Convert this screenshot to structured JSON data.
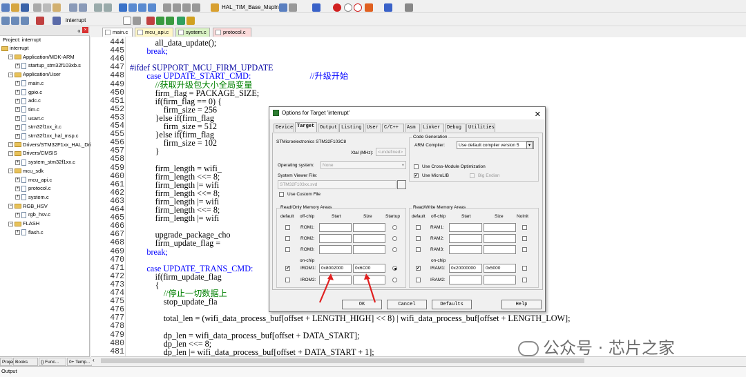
{
  "toolbar": {
    "target_func": "HAL_TIM_Base_MspInit",
    "target_name": "interrupt"
  },
  "project": {
    "header": "Project: interrupt",
    "tree": [
      {
        "label": "interrupt",
        "level": 0,
        "kind": "root"
      },
      {
        "label": "Application/MDK-ARM",
        "level": 1,
        "kind": "folder"
      },
      {
        "label": "startup_stm32f103xb.s",
        "level": 2,
        "kind": "file"
      },
      {
        "label": "Application/User",
        "level": 1,
        "kind": "folder"
      },
      {
        "label": "main.c",
        "level": 2,
        "kind": "file"
      },
      {
        "label": "gpio.c",
        "level": 2,
        "kind": "file"
      },
      {
        "label": "adc.c",
        "level": 2,
        "kind": "file"
      },
      {
        "label": "tim.c",
        "level": 2,
        "kind": "file"
      },
      {
        "label": "usart.c",
        "level": 2,
        "kind": "file"
      },
      {
        "label": "stm32f1xx_it.c",
        "level": 2,
        "kind": "file"
      },
      {
        "label": "stm32f1xx_hal_msp.c",
        "level": 2,
        "kind": "file"
      },
      {
        "label": "Drivers/STM32F1xx_HAL_Driver",
        "level": 1,
        "kind": "folder"
      },
      {
        "label": "Drivers/CMSIS",
        "level": 1,
        "kind": "folder"
      },
      {
        "label": "system_stm32f1xx.c",
        "level": 2,
        "kind": "file"
      },
      {
        "label": "mcu_sdk",
        "level": 1,
        "kind": "folder"
      },
      {
        "label": "mcu_api.c",
        "level": 2,
        "kind": "file"
      },
      {
        "label": "protocol.c",
        "level": 2,
        "kind": "file"
      },
      {
        "label": "system.c",
        "level": 2,
        "kind": "file"
      },
      {
        "label": "RGB_HSV",
        "level": 1,
        "kind": "folder"
      },
      {
        "label": "rgb_hsv.c",
        "level": 2,
        "kind": "file"
      },
      {
        "label": "FLASH",
        "level": 1,
        "kind": "folder"
      },
      {
        "label": "flash.c",
        "level": 2,
        "kind": "file"
      }
    ],
    "bottom_tabs": [
      "Project",
      "Books",
      "{} Func...",
      "0+ Temp..."
    ]
  },
  "editor_tabs": [
    {
      "label": "main.c",
      "color": "#ffffff"
    },
    {
      "label": "mcu_api.c",
      "color": "#fff7c8"
    },
    {
      "label": "system.c",
      "color": "#d9f2c4"
    },
    {
      "label": "protocol.c",
      "color": "#fbdada"
    }
  ],
  "code": {
    "lines": [
      {
        "n": "444",
        "t": "            all_data_update();",
        "c": ""
      },
      {
        "n": "445",
        "t": "        break;",
        "c": "kw"
      },
      {
        "n": "446",
        "t": "",
        "c": ""
      },
      {
        "n": "447",
        "t": "#ifdef SUPPORT_MCU_FIRM_UPDATE",
        "c": "pp"
      },
      {
        "n": "448",
        "t": "        case UPDATE_START_CMD:                            //升级开始",
        "c": "kw"
      },
      {
        "n": "449",
        "t": "            //获取升级包大小全局变量",
        "c": "cm"
      },
      {
        "n": "450",
        "t": "            firm_flag = PACKAGE_SIZE;",
        "c": ""
      },
      {
        "n": "451",
        "t": "            if(firm_flag == 0) {",
        "c": ""
      },
      {
        "n": "452",
        "t": "                firm_size = 256",
        "c": ""
      },
      {
        "n": "453",
        "t": "            }else if(firm_flag",
        "c": ""
      },
      {
        "n": "454",
        "t": "                firm_size = 512",
        "c": ""
      },
      {
        "n": "455",
        "t": "            }else if(firm_flag",
        "c": ""
      },
      {
        "n": "456",
        "t": "                firm_size = 102",
        "c": ""
      },
      {
        "n": "457",
        "t": "            }",
        "c": ""
      },
      {
        "n": "458",
        "t": "",
        "c": ""
      },
      {
        "n": "459",
        "t": "            firm_length = wifi_",
        "c": ""
      },
      {
        "n": "460",
        "t": "            firm_length <<= 8;",
        "c": ""
      },
      {
        "n": "461",
        "t": "            firm_length |= wifi",
        "c": ""
      },
      {
        "n": "462",
        "t": "            firm_length <<= 8;",
        "c": ""
      },
      {
        "n": "463",
        "t": "            firm_length |= wifi",
        "c": ""
      },
      {
        "n": "464",
        "t": "            firm_length <<= 8;",
        "c": ""
      },
      {
        "n": "465",
        "t": "            firm_length |= wifi",
        "c": ""
      },
      {
        "n": "466",
        "t": "",
        "c": ""
      },
      {
        "n": "467",
        "t": "            upgrade_package_cho",
        "c": ""
      },
      {
        "n": "468",
        "t": "            firm_update_flag =",
        "c": ""
      },
      {
        "n": "469",
        "t": "        break;",
        "c": "kw"
      },
      {
        "n": "470",
        "t": "",
        "c": ""
      },
      {
        "n": "471",
        "t": "        case UPDATE_TRANS_CMD:",
        "c": "kw"
      },
      {
        "n": "472",
        "t": "            if(firm_update_flag",
        "c": ""
      },
      {
        "n": "473",
        "t": "            {",
        "c": ""
      },
      {
        "n": "474",
        "t": "                //停止一切数据上",
        "c": "cm"
      },
      {
        "n": "475",
        "t": "                stop_update_fla",
        "c": ""
      },
      {
        "n": "476",
        "t": "",
        "c": ""
      },
      {
        "n": "477",
        "t": "                total_len = (wifi_data_process_buf[offset + LENGTH_HIGH] << 8) | wifi_data_process_buf[offset + LENGTH_LOW];",
        "c": ""
      },
      {
        "n": "478",
        "t": "",
        "c": ""
      },
      {
        "n": "479",
        "t": "                dp_len = wifi_data_process_buf[offset + DATA_START];",
        "c": ""
      },
      {
        "n": "480",
        "t": "                dp_len <<= 8;",
        "c": ""
      },
      {
        "n": "481",
        "t": "                dp_len |= wifi_data_process_buf[offset + DATA_START + 1];",
        "c": ""
      }
    ]
  },
  "dialog": {
    "title": "Options for Target 'interrupt'",
    "tabs": [
      "Device",
      "Target",
      "Output",
      "Listing",
      "User",
      "C/C++",
      "Asm",
      "Linker",
      "Debug",
      "Utilities"
    ],
    "active_tab": "Target",
    "device": "STMicroelectronics STM32F103C8",
    "xtal_label": "Xtal (MHz):",
    "xtal_value": "<undefined>",
    "os_label": "Operating system:",
    "os_value": "None",
    "svf_label": "System Viewer File:",
    "svf_value": "STM32F103xx.svd",
    "custom_file": "Use Custom File",
    "code_gen": "Code Generation",
    "compiler_label": "ARM Compiler:",
    "compiler_value": "Use default compiler version 5",
    "cross_module": "Use Cross-Module Optimization",
    "microlib": "Use MicroLIB",
    "big_endian": "Big Endian",
    "ro_title": "Read/Only Memory Areas",
    "rw_title": "Read/Write Memory Areas",
    "col_default": "default",
    "col_offchip": "off-chip",
    "col_start": "Start",
    "col_size": "Size",
    "col_startup": "Startup",
    "col_noinit": "NoInit",
    "onchip": "on-chip",
    "rom": [
      {
        "name": "ROM1:",
        "start": "",
        "size": "",
        "default": false,
        "startup": false
      },
      {
        "name": "ROM2:",
        "start": "",
        "size": "",
        "default": false,
        "startup": false
      },
      {
        "name": "ROM3:",
        "start": "",
        "size": "",
        "default": false,
        "startup": false
      },
      {
        "name": "IROM1:",
        "start": "0x8002000",
        "size": "0x6C00",
        "default": true,
        "startup": true
      },
      {
        "name": "IROM2:",
        "start": "",
        "size": "",
        "default": false,
        "startup": false
      }
    ],
    "ram": [
      {
        "name": "RAM1:",
        "start": "",
        "size": ""
      },
      {
        "name": "RAM2:",
        "start": "",
        "size": ""
      },
      {
        "name": "RAM3:",
        "start": "",
        "size": ""
      },
      {
        "name": "IRAM1:",
        "start": "0x20000000",
        "size": "0x5000",
        "default": true
      },
      {
        "name": "IRAM2:",
        "start": "",
        "size": ""
      }
    ],
    "ok": "OK",
    "cancel": "Cancel",
    "defaults": "Defaults",
    "help": "Help"
  },
  "output_label": "Output",
  "watermark": "公众号 · 芯片之家",
  "accent": "#e02020"
}
